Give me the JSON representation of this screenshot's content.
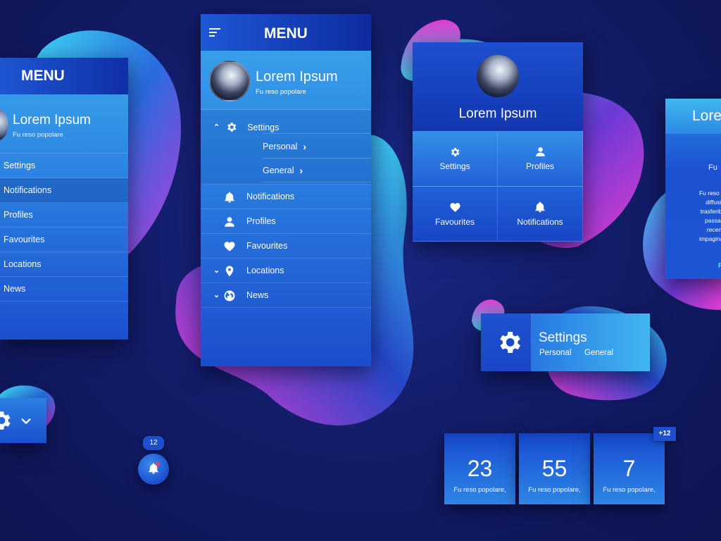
{
  "colors": {
    "background": "#131d6a",
    "panel_top": "#1d56d3",
    "panel_light": "#3aa7ea",
    "blob_cyan": "#3fd3f2",
    "blob_magenta": "#d83ad8",
    "accent_link": "#5ff0d0"
  },
  "left_menu": {
    "title": "MENU",
    "profile_name": "Lorem Ipsum",
    "profile_subtitle": "Fu reso popolare",
    "items": [
      {
        "label": "Settings"
      },
      {
        "label": "Notifications",
        "active": true
      },
      {
        "label": "Profiles"
      },
      {
        "label": "Favourites"
      },
      {
        "label": "Locations"
      },
      {
        "label": "News"
      }
    ]
  },
  "center_menu": {
    "title": "MENU",
    "profile_name": "Lorem Ipsum",
    "profile_subtitle": "Fu reso popolare",
    "settings_label": "Settings",
    "settings_sub": [
      {
        "label": "Personal"
      },
      {
        "label": "General"
      }
    ],
    "items": [
      {
        "label": "Notifications",
        "icon": "bell-icon"
      },
      {
        "label": "Profiles",
        "icon": "user-icon"
      },
      {
        "label": "Favourites",
        "icon": "heart-icon"
      },
      {
        "label": "Locations",
        "icon": "pin-icon"
      },
      {
        "label": "News",
        "icon": "globe-icon"
      }
    ]
  },
  "grid_card": {
    "profile_name": "Lorem Ipsum",
    "cells": [
      {
        "label": "Settings",
        "icon": "gear-icon"
      },
      {
        "label": "Profiles",
        "icon": "user-icon"
      },
      {
        "label": "Favourites",
        "icon": "heart-icon"
      },
      {
        "label": "Notifications",
        "icon": "bell-icon"
      }
    ]
  },
  "right_card": {
    "title": "Lore",
    "subtitle": "Fu",
    "paragraph_lines": [
      "Fu reso popo",
      "diffusion",
      "trasferibili \"L",
      "passaggi",
      "recente",
      "impaginazion"
    ],
    "link": "F"
  },
  "settings_card": {
    "title": "Settings",
    "options": [
      "Personal",
      "General"
    ]
  },
  "notification": {
    "badge": "12"
  },
  "stats": {
    "extra_badge": "+12",
    "items": [
      {
        "value": "23",
        "caption": "Fu reso popolare,"
      },
      {
        "value": "55",
        "caption": "Fu reso popolare,"
      },
      {
        "value": "7",
        "caption": "Fu reso popolare,"
      }
    ]
  }
}
